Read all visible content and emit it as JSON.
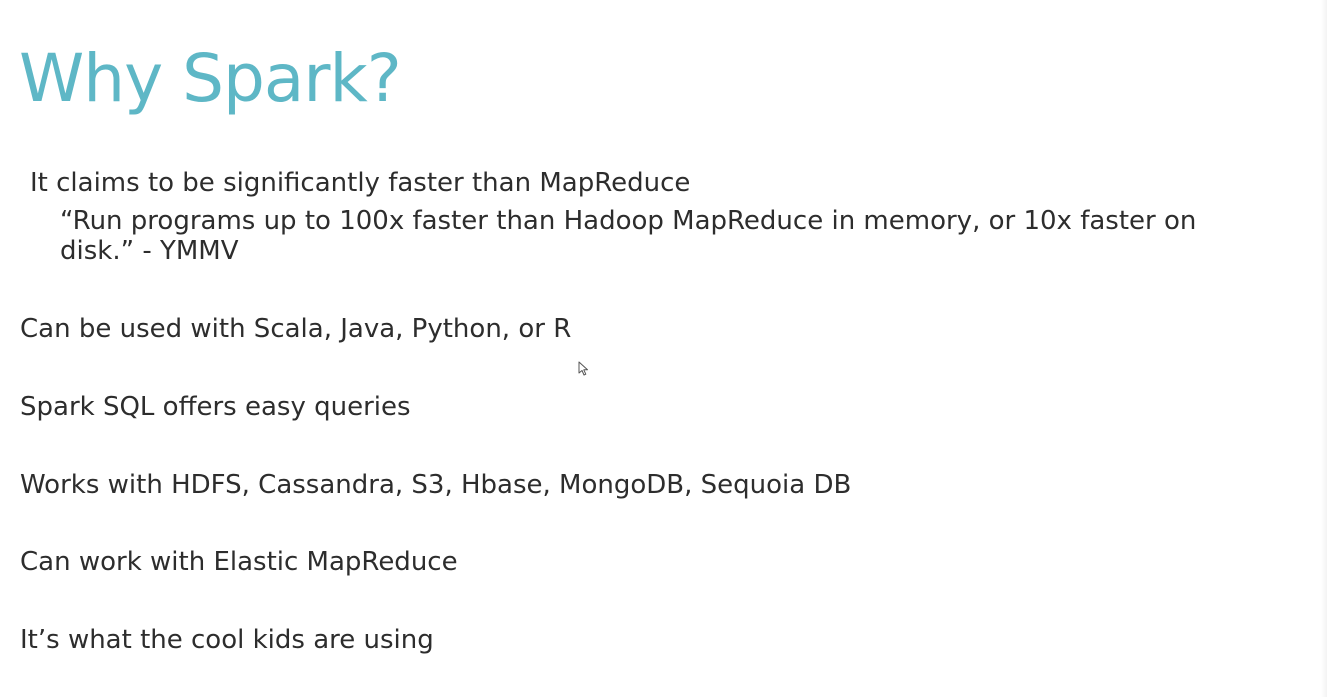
{
  "slide": {
    "title": "Why Spark?",
    "claim": "It claims to be significantly faster than MapReduce",
    "quote": "“Run programs up to 100x faster than Hadoop MapReduce in memory, or 10x faster on disk.”    - YMMV",
    "bullets": [
      "Can be used with Scala, Java, Python, or R",
      "Spark SQL offers easy queries",
      "Works with HDFS, Cassandra, S3, Hbase, MongoDB, Sequoia DB",
      "Can work with Elastic MapReduce",
      "It’s what the cool kids are using"
    ]
  },
  "colors": {
    "title": "#5eb7c6",
    "text": "#2d2d2d",
    "background": "#ffffff"
  },
  "icons": {
    "cursor": "mouse-pointer-icon"
  }
}
